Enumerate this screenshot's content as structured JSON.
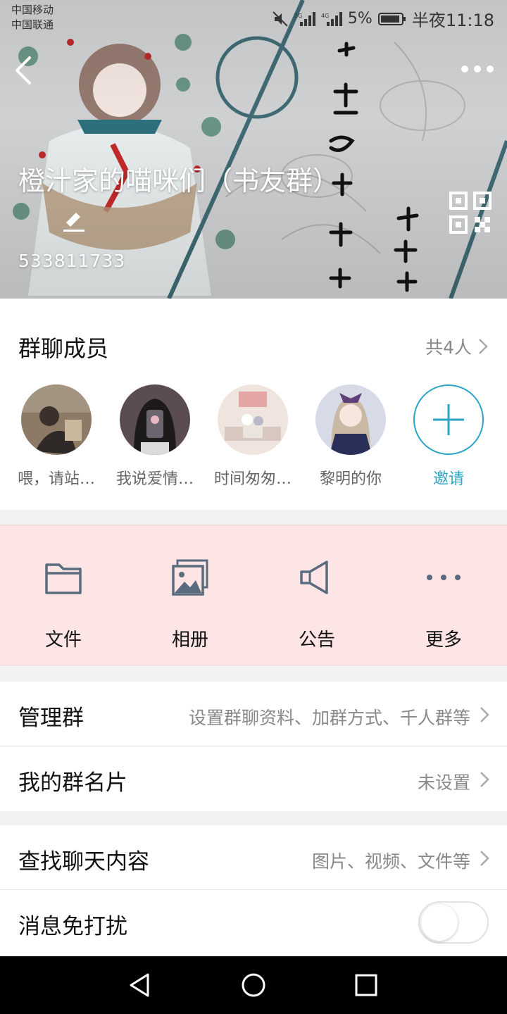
{
  "status_bar": {
    "carrier_1": "中国移动",
    "carrier_2": "中国联通",
    "network_1": "2G",
    "network_2": "4G",
    "battery": "5%",
    "time": "半夜11:18"
  },
  "header": {
    "group_name": "橙汁家的喵咪们（书友群）",
    "group_id": "533811733",
    "icons": {
      "back": "back-arrow-icon",
      "more": "more-dots-icon",
      "edit": "edit-pen-icon",
      "qr": "qr-code-icon"
    }
  },
  "members": {
    "title": "群聊成员",
    "count_label": "共4人",
    "items": [
      {
        "name": "喂，请站…",
        "color": "#6a5a4a"
      },
      {
        "name": "我说爱情…",
        "color": "#3a3436"
      },
      {
        "name": "时间匆匆…",
        "color": "#e7d7cf"
      },
      {
        "name": "黎明的你",
        "color": "#5a5f8a"
      }
    ],
    "invite_label": "邀请",
    "accent_color": "#2aa5c6"
  },
  "shortcuts": [
    {
      "label": "文件",
      "icon": "folder-icon"
    },
    {
      "label": "相册",
      "icon": "photo-album-icon"
    },
    {
      "label": "公告",
      "icon": "megaphone-icon"
    },
    {
      "label": "更多",
      "icon": "more-horizontal-icon"
    }
  ],
  "settings": {
    "manage": {
      "title": "管理群",
      "value": "设置群聊资料、加群方式、千人群等"
    },
    "card": {
      "title": "我的群名片",
      "value": "未设置"
    },
    "search": {
      "title": "查找聊天内容",
      "value": "图片、视频、文件等"
    },
    "dnd": {
      "title": "消息免打扰",
      "enabled": false
    }
  }
}
